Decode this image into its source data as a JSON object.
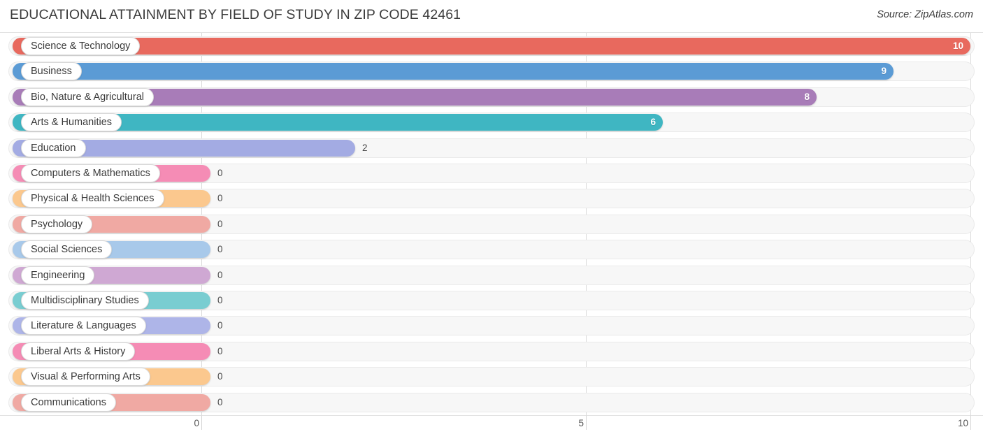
{
  "header": {
    "title": "EDUCATIONAL ATTAINMENT BY FIELD OF STUDY IN ZIP CODE 42461",
    "source": "Source: ZipAtlas.com"
  },
  "chart_data": {
    "type": "bar",
    "orientation": "horizontal",
    "title": "EDUCATIONAL ATTAINMENT BY FIELD OF STUDY IN ZIP CODE 42461",
    "subtitle": "Source: ZipAtlas.com",
    "xlabel": "",
    "ylabel": "",
    "xlim": [
      0,
      10
    ],
    "xticks": [
      0,
      5,
      10
    ],
    "xtick_labels": [
      "0",
      "5",
      "10"
    ],
    "grid": true,
    "legend": false,
    "categories": [
      "Science & Technology",
      "Business",
      "Bio, Nature & Agricultural",
      "Arts & Humanities",
      "Education",
      "Computers & Mathematics",
      "Physical & Health Sciences",
      "Psychology",
      "Social Sciences",
      "Engineering",
      "Multidisciplinary Studies",
      "Literature & Languages",
      "Liberal Arts & History",
      "Visual & Performing Arts",
      "Communications"
    ],
    "values": [
      10,
      9,
      8,
      6,
      2,
      0,
      0,
      0,
      0,
      0,
      0,
      0,
      0,
      0,
      0
    ],
    "value_labels": [
      "10",
      "9",
      "8",
      "6",
      "2",
      "0",
      "0",
      "0",
      "0",
      "0",
      "0",
      "0",
      "0",
      "0",
      "0"
    ],
    "colors": [
      "#e8695e",
      "#5b9bd5",
      "#a87cb8",
      "#3fb6c2",
      "#a3abe3",
      "#f58cb5",
      "#fbc88e",
      "#f0a9a3",
      "#a8c9ea",
      "#cfa8d3",
      "#79cdd1",
      "#aeb5e8",
      "#f58cb5",
      "#fbc88e",
      "#f0a9a3"
    ]
  }
}
